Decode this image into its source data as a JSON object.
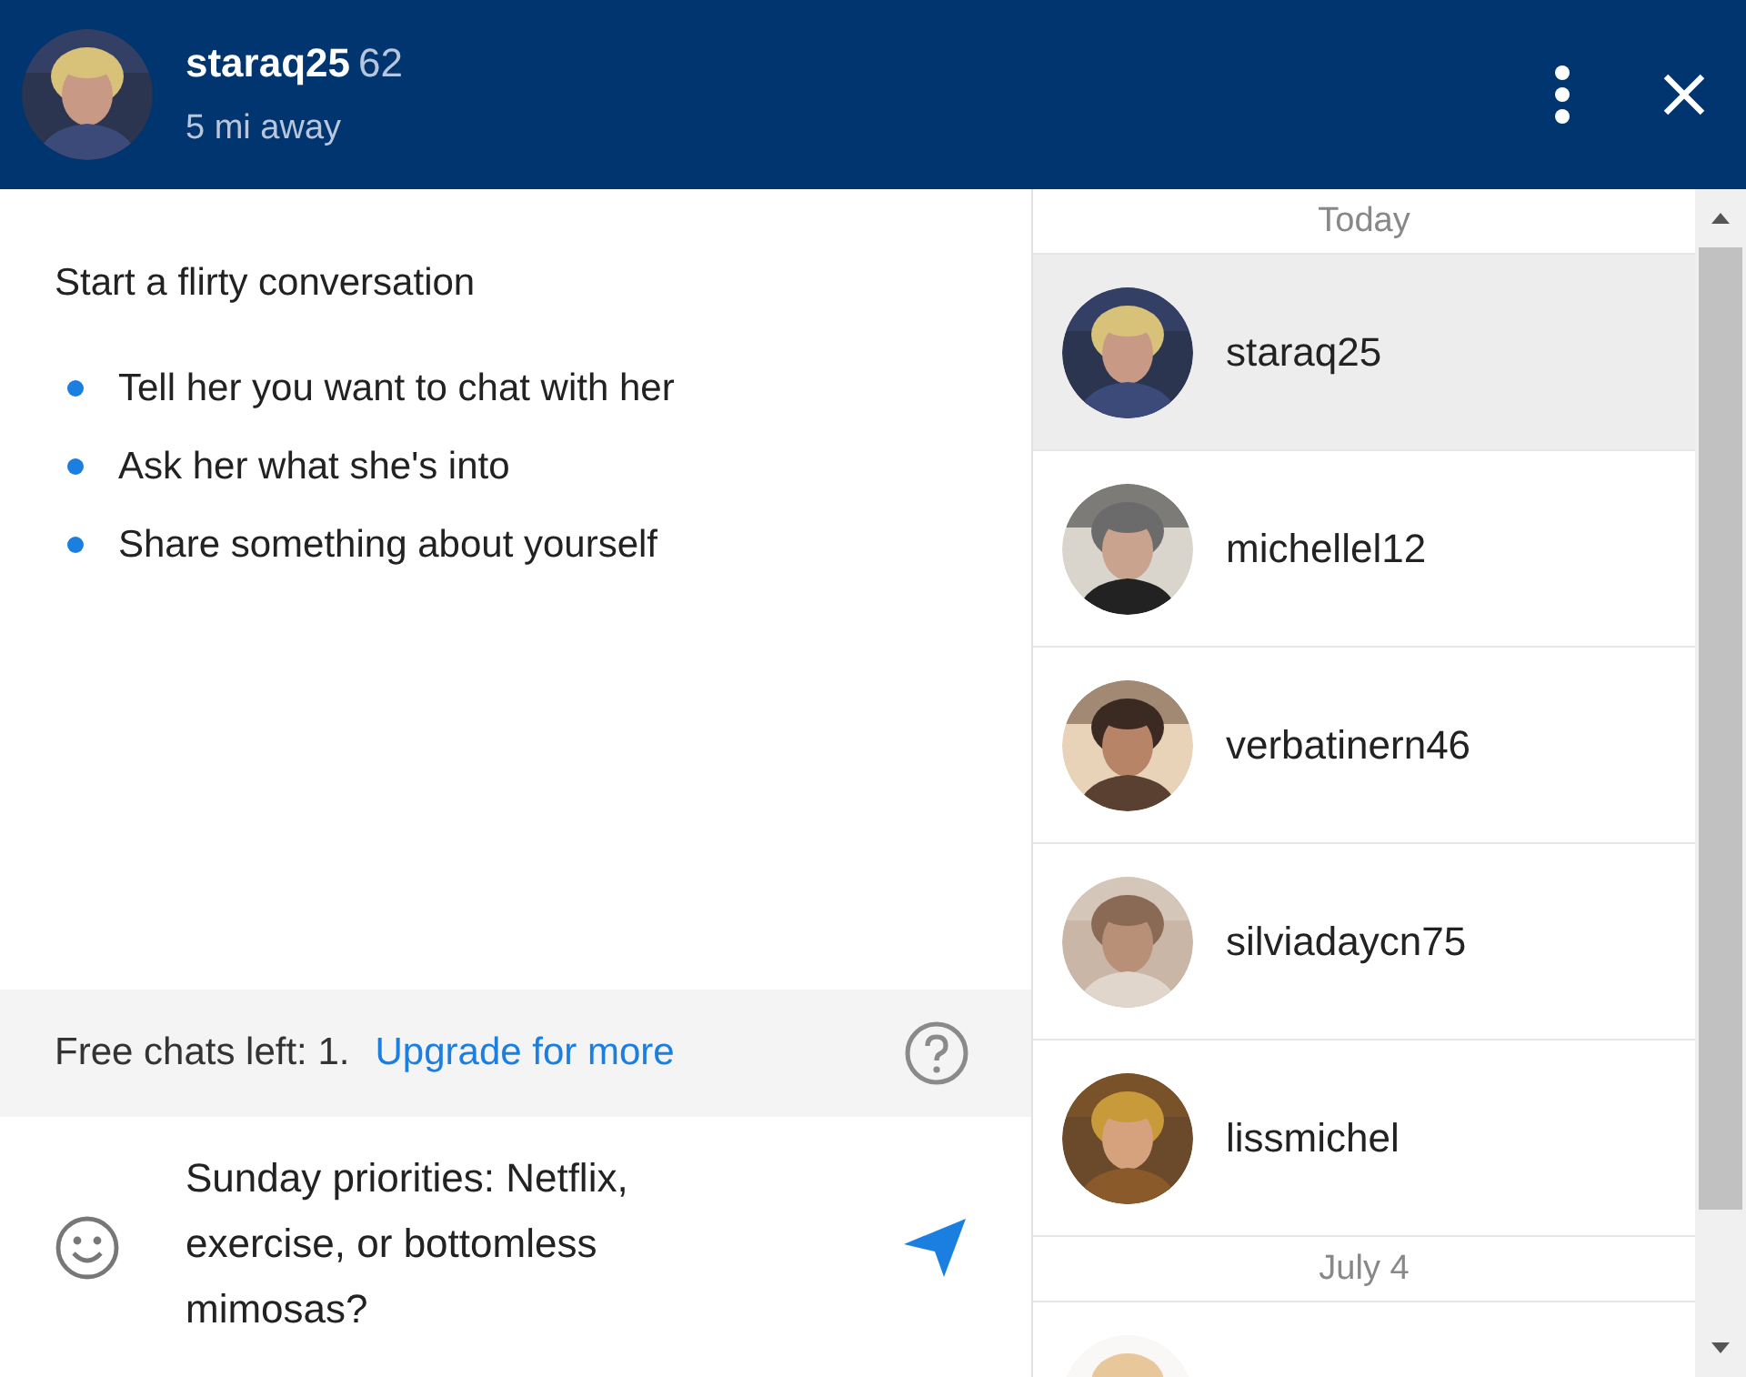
{
  "header": {
    "username": "staraq25",
    "age": "62",
    "distance": "5 mi away"
  },
  "tips": {
    "title": "Start a flirty conversation",
    "items": [
      "Tell her you want to chat with her",
      "Ask her what she's into",
      "Share something about yourself"
    ]
  },
  "quota": {
    "text": "Free chats left: 1.",
    "link": "Upgrade for more"
  },
  "composer": {
    "value": "Sunday priorities: Netflix, exercise, or bottomless mimosas?"
  },
  "conversations": [
    {
      "date": "Today",
      "items": [
        {
          "name": "staraq25",
          "selected": true
        },
        {
          "name": "michellel12",
          "selected": false
        },
        {
          "name": "verbatinern46",
          "selected": false
        },
        {
          "name": "silviadaycn75",
          "selected": false
        },
        {
          "name": "lissmichel",
          "selected": false
        }
      ]
    },
    {
      "date": "July 4",
      "items": [
        {
          "selected": false
        }
      ]
    }
  ]
}
